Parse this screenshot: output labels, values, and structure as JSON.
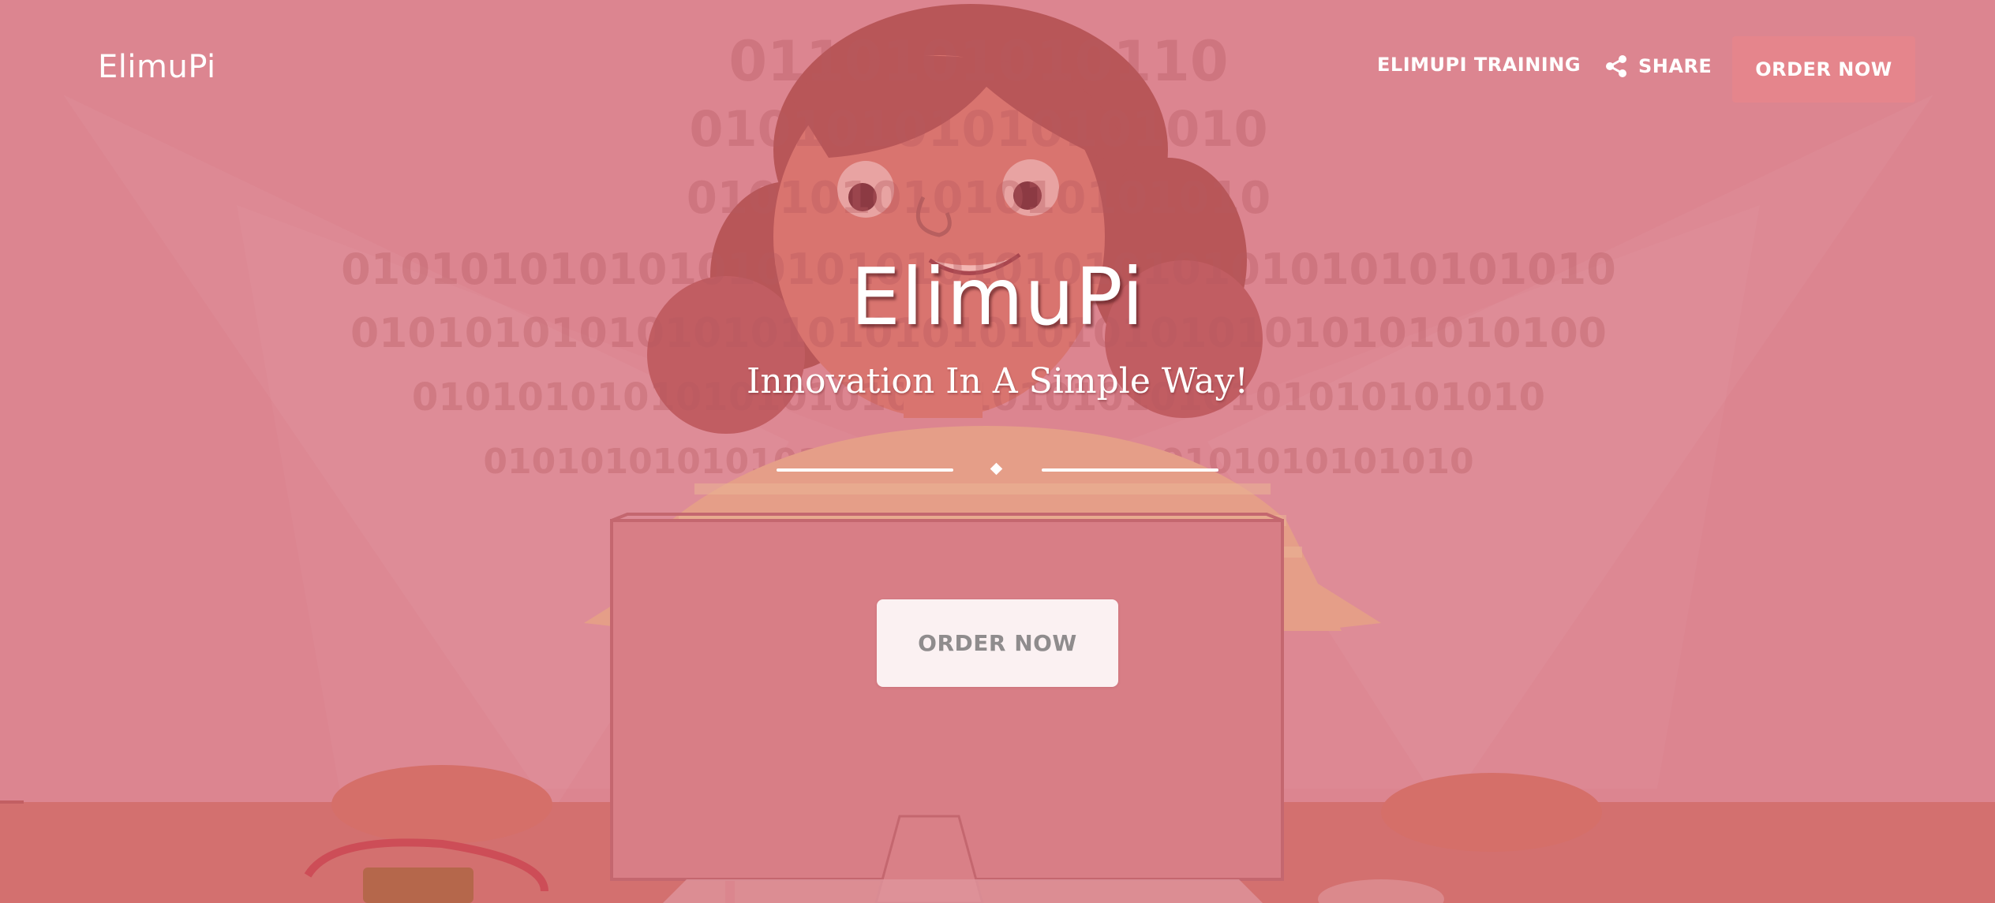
{
  "brand": {
    "name": "ElimuPi"
  },
  "nav": {
    "training_label": "ELIMUPI TRAINING",
    "share_label": "SHARE",
    "order_label": "ORDER NOW",
    "share_icon": "share-icon"
  },
  "hero": {
    "title": "ElimuPi",
    "subtitle": "Innovation In A Simple Way!",
    "divider_icon": "diamond-icon",
    "cta_label": "ORDER NOW",
    "background_illustration": "girl-at-computer-illustration"
  },
  "colors": {
    "overlay": "#dc8590",
    "nav_button": "#e5858c",
    "cta_background": "#fbf1f2",
    "cta_text": "#8f8c8d",
    "text": "#ffffff"
  }
}
